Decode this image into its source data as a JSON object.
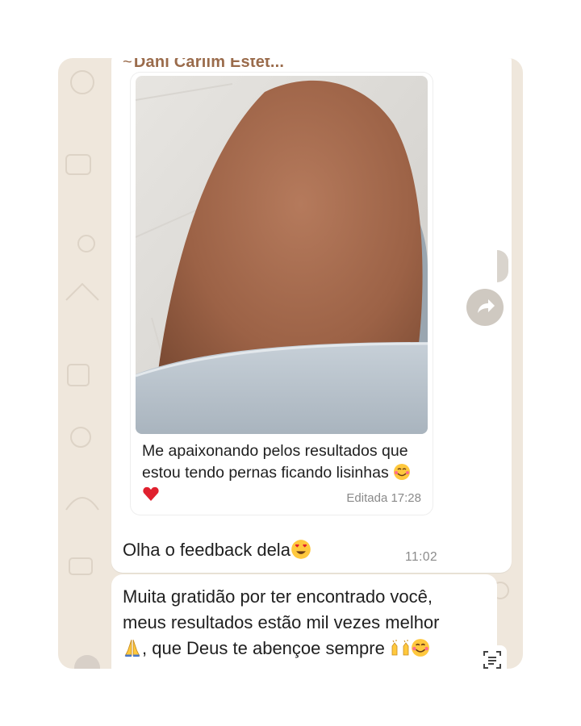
{
  "message1": {
    "sender": "Dani Carlim Estét...",
    "sender_prefix": "~",
    "quoted_text": "Me apaixonando pelos resultados que estou tendo pernas ficando lisinhas",
    "quoted_meta_label": "Editada",
    "quoted_time": "17:28"
  },
  "message2": {
    "text": "Olha o feedback dela",
    "time": "11:02"
  },
  "message3": {
    "text_line1": "Muita gratidão por ter encontrado você,",
    "text_line2": "meus resultados estão mil vezes melhor",
    "text_line3": ", que Deus te abençoe sempre"
  },
  "icons": {
    "forward": "forward-arrow-icon",
    "copy_text": "text-recognition-icon",
    "emojis": [
      "smiling-face-with-hearts",
      "red-heart",
      "heart-eyes",
      "folded-hands",
      "raising-hands",
      "smiling-face-with-hearts"
    ]
  },
  "colors": {
    "chat_bg": "#efe7dc",
    "sender_name": "#9a6b4b",
    "bubble": "#ffffff",
    "meta_text": "#8a8a8a"
  }
}
